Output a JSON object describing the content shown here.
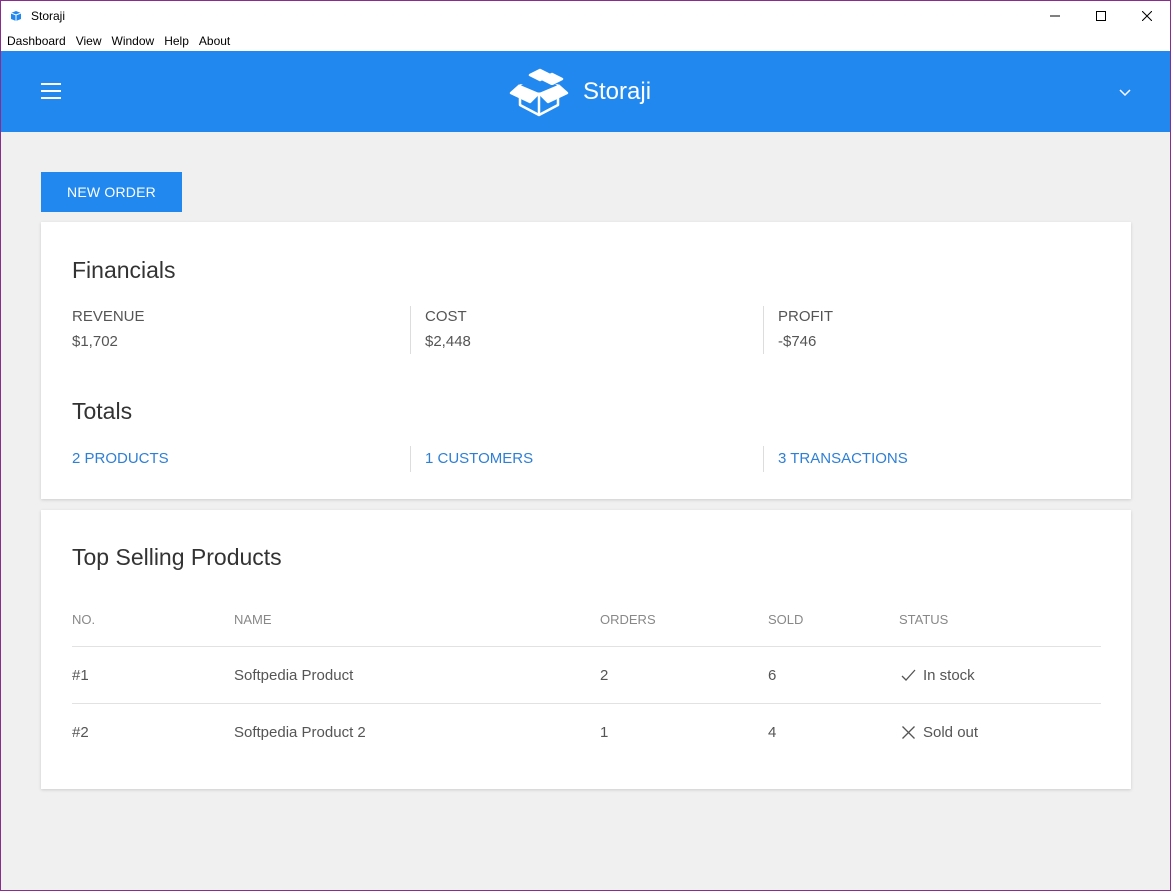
{
  "window": {
    "title": "Storaji",
    "controls": {
      "minimize": "minimize-icon",
      "maximize": "maximize-icon",
      "close": "close-icon"
    }
  },
  "menubar": {
    "items": [
      "Dashboard",
      "View",
      "Window",
      "Help",
      "About"
    ]
  },
  "header": {
    "brand": "Storaji",
    "menu_icon": "hamburger-icon",
    "logo_icon": "boxes-logo-icon",
    "account_icon": "chevron-down-icon"
  },
  "actions": {
    "new_order_label": "NEW ORDER"
  },
  "financials": {
    "title": "Financials",
    "items": [
      {
        "label": "REVENUE",
        "value": "$1,702"
      },
      {
        "label": "COST",
        "value": "$2,448"
      },
      {
        "label": "PROFIT",
        "value": "-$746"
      }
    ]
  },
  "totals": {
    "title": "Totals",
    "links": [
      "2 PRODUCTS",
      "1 CUSTOMERS",
      "3 TRANSACTIONS"
    ]
  },
  "top_selling": {
    "title": "Top Selling Products",
    "columns": [
      "NO.",
      "NAME",
      "ORDERS",
      "SOLD",
      "STATUS"
    ],
    "rows": [
      {
        "no": "#1",
        "name": "Softpedia Product",
        "orders": "2",
        "sold": "6",
        "status": "In stock",
        "status_icon": "check-icon"
      },
      {
        "no": "#2",
        "name": "Softpedia Product 2",
        "orders": "1",
        "sold": "4",
        "status": "Sold out",
        "status_icon": "x-icon"
      }
    ]
  },
  "colors": {
    "brand_blue": "#2188f0",
    "link_blue": "#2e7fd6",
    "background": "#f0f0f0",
    "window_border": "#8a2c8e"
  }
}
